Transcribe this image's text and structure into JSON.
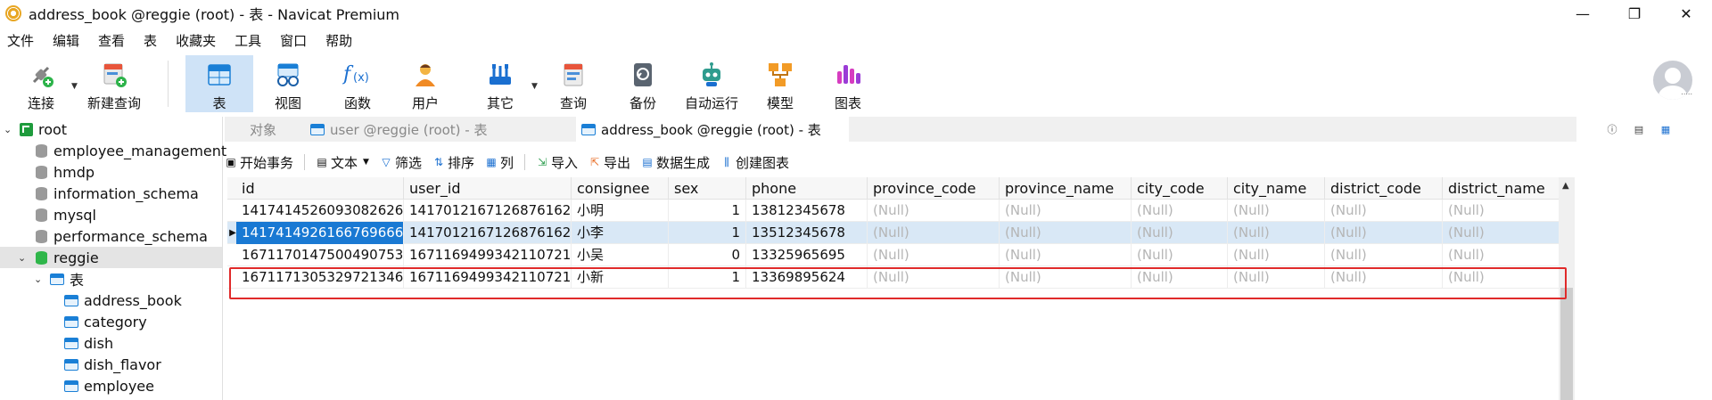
{
  "window": {
    "title": "address_book @reggie (root) - 表 - Navicat Premium",
    "controls": [
      "—",
      "❐",
      "✕"
    ]
  },
  "menu": [
    "文件",
    "编辑",
    "查看",
    "表",
    "收藏夹",
    "工具",
    "窗口",
    "帮助"
  ],
  "toolbar": {
    "buttons": [
      {
        "label": "连接",
        "icon": "plug-icon"
      },
      {
        "label": "新建查询",
        "icon": "new-query-icon"
      },
      {
        "label": "表",
        "icon": "table-icon",
        "active": true
      },
      {
        "label": "视图",
        "icon": "view-glasses-icon"
      },
      {
        "label": "函数",
        "icon": "function-icon"
      },
      {
        "label": "用户",
        "icon": "user-icon"
      },
      {
        "label": "其它",
        "icon": "tools-icon"
      },
      {
        "label": "查询",
        "icon": "query-icon"
      },
      {
        "label": "备份",
        "icon": "backup-icon"
      },
      {
        "label": "自动运行",
        "icon": "robot-icon"
      },
      {
        "label": "模型",
        "icon": "model-icon"
      },
      {
        "label": "图表",
        "icon": "chart-icon"
      }
    ],
    "avatar_dots": "....."
  },
  "sidebar": {
    "root": "root",
    "databases": [
      "employee_management",
      "hmdp",
      "information_schema",
      "mysql",
      "performance_schema",
      "reggie"
    ],
    "tables_folder": "表",
    "tables": [
      "address_book",
      "category",
      "dish",
      "dish_flavor",
      "employee"
    ]
  },
  "tabs": [
    {
      "label": "对象"
    },
    {
      "label": "user @reggie (root) - 表"
    },
    {
      "label": "address_book @reggie (root) - 表"
    }
  ],
  "gridbar": {
    "begin_transaction": "开始事务",
    "text": "文本",
    "filter": "筛选",
    "sort": "排序",
    "columns": "列",
    "import": "导入",
    "export": "导出",
    "data_generation": "数据生成",
    "create_chart": "创建图表"
  },
  "grid": {
    "columns": [
      "id",
      "user_id",
      "consignee",
      "sex",
      "phone",
      "province_code",
      "province_name",
      "city_code",
      "city_name",
      "district_code",
      "district_name"
    ],
    "rows": [
      [
        "1417414526093082626",
        "1417012167126876162",
        "小明",
        "1",
        "13812345678",
        "(Null)",
        "(Null)",
        "(Null)",
        "(Null)",
        "(Null)",
        "(Null)"
      ],
      [
        "1417414926166769666",
        "1417012167126876162",
        "小李",
        "1",
        "13512345678",
        "(Null)",
        "(Null)",
        "(Null)",
        "(Null)",
        "(Null)",
        "(Null)"
      ],
      [
        "1671170147500490753",
        "1671169499342110721",
        "小吴",
        "0",
        "13325965695",
        "(Null)",
        "(Null)",
        "(Null)",
        "(Null)",
        "(Null)",
        "(Null)"
      ],
      [
        "1671171305329721346",
        "1671169499342110721",
        "小新",
        "1",
        "13369895624",
        "(Null)",
        "(Null)",
        "(Null)",
        "(Null)",
        "(Null)",
        "(Null)"
      ]
    ],
    "selected_row": 1,
    "selected_cell_text_color": "#ffffff",
    "selected_cell_bg": "#1979d3",
    "null_color": "#b5b5b5",
    "highlight_box_color": "#e02a2a"
  }
}
